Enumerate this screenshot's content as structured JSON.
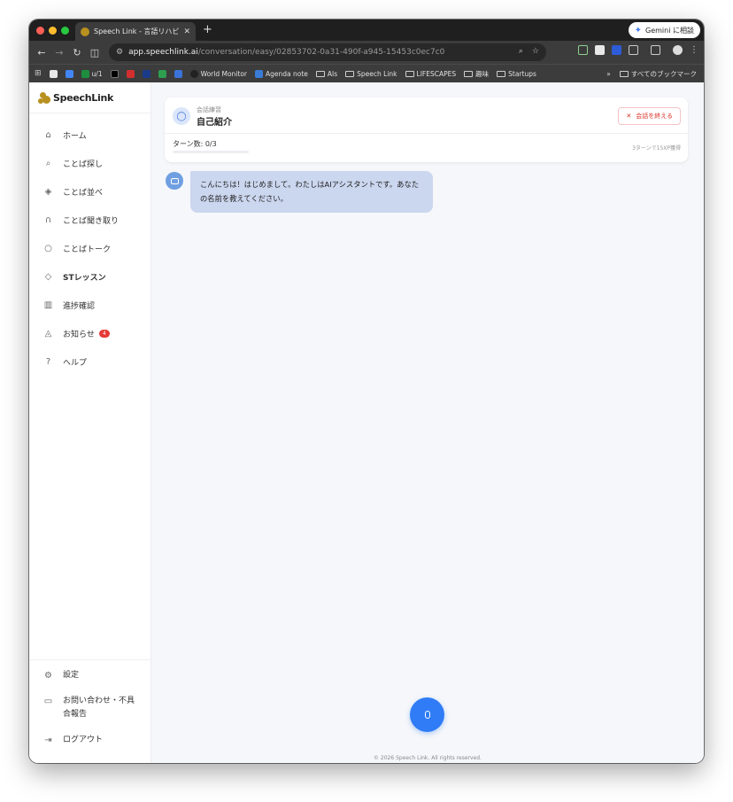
{
  "browser": {
    "tab_title": "Speech Link - 言語リハビリ支援",
    "gemini_label": "Gemini に相談",
    "url_host": "app.speechlink.ai",
    "url_path": "/conversation/easy/02853702-0a31-490f-a945-15453c0ec7c0",
    "bookmarks": [
      "u/1",
      "World Monitor",
      "Agenda note",
      "AIs",
      "Speech Link",
      "LIFESCAPES",
      "趣味",
      "Startups"
    ],
    "all_bookmarks": "すべてのブックマーク"
  },
  "sidebar": {
    "brand": "SpeechLink",
    "items": [
      {
        "label": "ホーム",
        "icon": "home-icon"
      },
      {
        "label": "ことば探し",
        "icon": "search-icon"
      },
      {
        "label": "ことば並べ",
        "icon": "layers-icon"
      },
      {
        "label": "ことば聞き取り",
        "icon": "headphones-icon"
      },
      {
        "label": "ことばトーク",
        "icon": "chat-bubble-icon"
      },
      {
        "label": "STレッスン",
        "icon": "graduation-cap-icon"
      },
      {
        "label": "進捗確認",
        "icon": "bar-chart-icon"
      },
      {
        "label": "お知らせ",
        "icon": "bell-icon",
        "badge": "4"
      },
      {
        "label": "ヘルプ",
        "icon": "help-circle-icon"
      }
    ],
    "bottom": [
      {
        "label": "設定",
        "icon": "gear-icon"
      },
      {
        "label": "お問い合わせ・不具合報告",
        "icon": "feedback-icon"
      },
      {
        "label": "ログアウト",
        "icon": "logout-icon"
      }
    ]
  },
  "conversation": {
    "category": "会話練習",
    "title": "自己紹介",
    "end_button": "会話を終える",
    "turns_label": "ターン数: 0/3",
    "turns_progress": 0,
    "xp_note": "3ターンで15XP獲得",
    "messages": [
      {
        "role": "assistant",
        "text": "こんにちは！はじめまして。わたしはAIアシスタントです。あなたの名前を教えてください。"
      }
    ]
  },
  "footer": "© 2026 Speech Link. All rights reserved."
}
